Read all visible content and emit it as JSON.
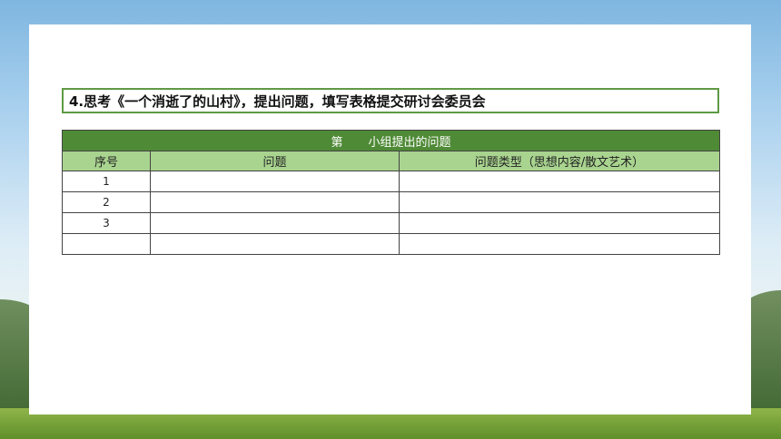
{
  "heading": "4.思考《一个消逝了的山村》，提出问题，填写表格提交研讨会委员会",
  "table": {
    "title_prefix": "第",
    "title_suffix": "小组提出的问题",
    "columns": [
      "序号",
      "问题",
      "问题类型（思想内容/散文艺术）"
    ],
    "rows": [
      [
        "1",
        "",
        ""
      ],
      [
        "2",
        "",
        ""
      ],
      [
        "3",
        "",
        ""
      ],
      [
        "",
        "",
        ""
      ]
    ]
  },
  "colors": {
    "title_bar": "#4f8a36",
    "header_row": "#a9d48f",
    "heading_border": "#5e9a44"
  }
}
